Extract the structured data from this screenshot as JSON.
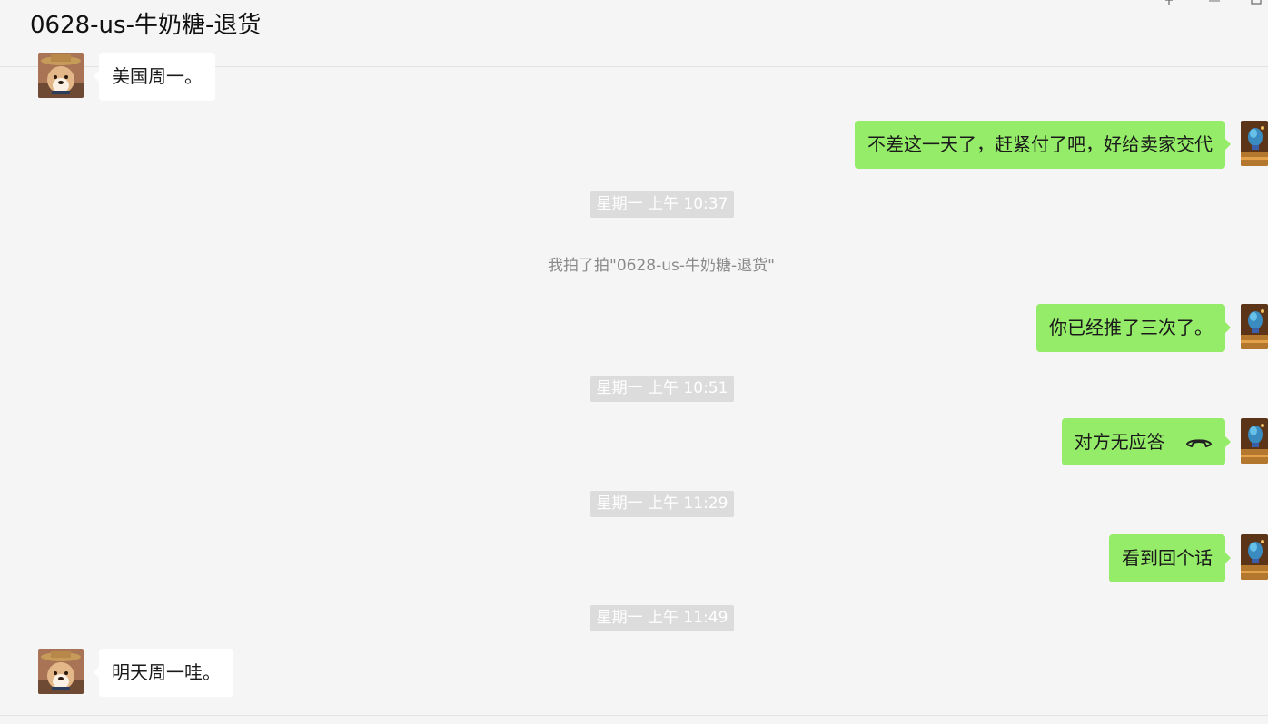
{
  "window": {
    "title": "0628-us-牛奶糖-退货",
    "controls": [
      "pin-icon",
      "minimize-icon",
      "maximize-icon"
    ]
  },
  "colors": {
    "background": "#f5f5f5",
    "self_bubble": "#95ec69",
    "other_bubble": "#ffffff",
    "timestamp_bg": "#dcdcdc",
    "system_text": "#8a8a8a"
  },
  "messages": [
    {
      "sender": "contact",
      "text": "美国周一。"
    },
    {
      "sender": "self",
      "text": "不差这一天了，赶紧付了吧，好给卖家交代"
    },
    {
      "type": "timestamp",
      "text": "星期一 上午 10:37"
    },
    {
      "type": "system",
      "text": "我拍了拍\"0628-us-牛奶糖-退货\""
    },
    {
      "sender": "self",
      "text": "你已经推了三次了。"
    },
    {
      "type": "timestamp",
      "text": "星期一 上午 10:51"
    },
    {
      "sender": "self",
      "text": "对方无应答",
      "icon": "hangup-phone-icon"
    },
    {
      "type": "timestamp",
      "text": "星期一 上午 11:29"
    },
    {
      "sender": "self",
      "text": "看到回个话"
    },
    {
      "type": "timestamp",
      "text": "星期一 上午 11:49"
    },
    {
      "sender": "contact",
      "text": "明天周一哇。"
    }
  ]
}
